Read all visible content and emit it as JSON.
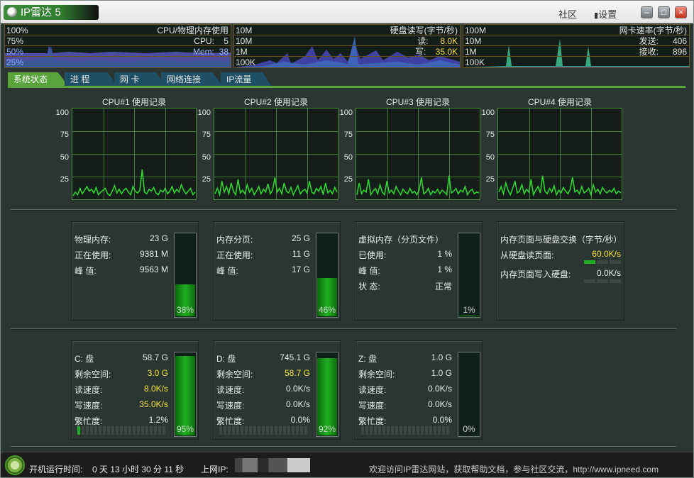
{
  "app": {
    "title": "IP雷达 5",
    "community": "社区",
    "settings": "设置",
    "settings_icon": "gear-icon"
  },
  "monitors": {
    "cpu": {
      "levels": [
        "100%",
        "75%",
        "50%",
        "25%"
      ],
      "title": "CPU/物理内存使用",
      "cpu_label": "CPU:",
      "cpu_value": "5",
      "mem_label": "Mem:",
      "mem_value": "38"
    },
    "disk": {
      "levels": [
        "10M",
        "10M",
        "1M",
        "100K"
      ],
      "title": "硬盘读写(字节/秒)",
      "read_label": "读:",
      "read_value": "8.0K",
      "write_label": "写:",
      "write_value": "35.0K"
    },
    "net": {
      "levels": [
        "100M",
        "10M",
        "1M",
        "100K"
      ],
      "title": "网卡速率(字节/秒)",
      "send_label": "发送:",
      "send_value": "406",
      "recv_label": "接收:",
      "recv_value": "896"
    }
  },
  "tabs": [
    "系统状态",
    "进  程",
    "网  卡",
    "网络连接",
    "IP流量"
  ],
  "active_tab": 0,
  "cpu_titles": [
    "CPU#1 使用记录",
    "CPU#2 使用记录",
    "CPU#3 使用记录",
    "CPU#4 使用记录"
  ],
  "y_ticks": [
    "100",
    "75",
    "50",
    "25"
  ],
  "chart_data": {
    "type": "line",
    "ylim": [
      0,
      100
    ],
    "series": [
      {
        "name": "CPU#1 使用记录",
        "values": [
          4,
          8,
          5,
          12,
          6,
          10,
          14,
          9,
          11,
          7,
          13,
          5,
          8,
          10,
          12,
          6,
          4,
          9,
          15,
          7,
          11,
          6,
          10,
          12,
          8,
          5,
          14,
          9,
          7,
          10,
          33,
          8,
          6,
          11,
          9,
          13,
          7,
          5,
          10,
          8,
          12,
          6,
          9,
          14,
          7,
          11,
          8,
          16,
          10,
          6,
          9,
          12,
          5,
          8
        ]
      },
      {
        "name": "CPU#2 使用记录",
        "values": [
          6,
          12,
          5,
          20,
          8,
          14,
          6,
          18,
          9,
          5,
          22,
          7,
          10,
          6,
          16,
          8,
          12,
          5,
          9,
          14,
          6,
          11,
          8,
          17,
          6,
          10,
          24,
          8,
          12,
          6,
          18,
          9,
          7,
          13,
          5,
          10,
          15,
          6,
          9,
          11,
          7,
          20,
          8,
          6,
          12,
          9,
          14,
          5,
          18,
          7,
          10,
          6,
          13,
          8
        ]
      },
      {
        "name": "CPU#3 使用记录",
        "values": [
          5,
          18,
          6,
          10,
          8,
          22,
          5,
          9,
          12,
          6,
          16,
          8,
          5,
          20,
          7,
          10,
          6,
          14,
          9,
          5,
          11,
          8,
          6,
          12,
          7,
          9,
          5,
          10,
          24,
          6,
          8,
          12,
          5,
          9,
          7,
          11,
          6,
          10,
          8,
          5,
          26,
          7,
          9,
          12,
          6,
          10,
          8,
          14,
          5,
          9,
          11,
          6,
          8,
          7
        ]
      },
      {
        "name": "CPU#4 使用记录",
        "values": [
          8,
          14,
          6,
          18,
          10,
          5,
          12,
          20,
          7,
          9,
          16,
          6,
          11,
          8,
          22,
          5,
          10,
          14,
          7,
          26,
          9,
          6,
          12,
          8,
          15,
          5,
          10,
          7,
          13,
          9,
          6,
          11,
          24,
          8,
          10,
          6,
          14,
          7,
          9,
          12,
          5,
          16,
          8,
          11,
          6,
          13,
          9,
          7,
          10,
          8,
          12,
          6,
          9,
          7
        ]
      }
    ]
  },
  "mem_panels": [
    {
      "rows": [
        [
          "物理内存:",
          "23 G"
        ],
        [
          "正在使用:",
          "9381 M"
        ],
        [
          "峰    值:",
          "9563 M"
        ]
      ],
      "pct": "38%",
      "level": 38
    },
    {
      "rows": [
        [
          "内存分页:",
          "25 G"
        ],
        [
          "正在使用:",
          "11 G"
        ],
        [
          "峰    值:",
          "17 G"
        ]
      ],
      "pct": "46%",
      "level": 46
    },
    {
      "rows": [
        [
          "虚拟内存（分页文件）",
          ""
        ],
        [
          "已使用:",
          "1 %"
        ],
        [
          "峰    值:",
          "1 %"
        ],
        [
          "状    态:",
          "正常"
        ]
      ],
      "pct": "1%",
      "level": 1
    }
  ],
  "swap_panel": {
    "title": "内存页面与硬盘交换（字节/秒）",
    "read_label": "从硬盘读页面:",
    "read_value": "60.0K/s",
    "write_label": "内存页面写入硬盘:",
    "write_value": "0.0K/s"
  },
  "disk_panels": [
    {
      "name": "C: 盘",
      "size": "58.7 G",
      "free_label": "剩余空间:",
      "free": "3.0 G",
      "free_warn": true,
      "rspeed_label": "读速度:",
      "rspeed": "8.0K/s",
      "rwarn": true,
      "wspeed_label": "写速度:",
      "wspeed": "35.0K/s",
      "wwarn": true,
      "busy_label": "繁忙度:",
      "busy": "1.2%",
      "busy_level": 1.2,
      "pct": "95%",
      "level": 95
    },
    {
      "name": "D: 盘",
      "size": "745.1 G",
      "free_label": "剩余空间:",
      "free": "58.7 G",
      "free_warn": true,
      "rspeed_label": "读速度:",
      "rspeed": "0.0K/s",
      "rwarn": false,
      "wspeed_label": "写速度:",
      "wspeed": "0.0K/s",
      "wwarn": false,
      "busy_label": "繁忙度:",
      "busy": "0.0%",
      "busy_level": 0,
      "pct": "92%",
      "level": 92
    },
    {
      "name": "Z: 盘",
      "size": "1.0 G",
      "free_label": "剩余空间:",
      "free": "1.0 G",
      "free_warn": false,
      "rspeed_label": "读速度:",
      "rspeed": "0.0K/s",
      "rwarn": false,
      "wspeed_label": "写速度:",
      "wspeed": "0.0K/s",
      "wwarn": false,
      "busy_label": "繁忙度:",
      "busy": "0.0%",
      "busy_level": 0,
      "pct": "0%",
      "level": 0
    }
  ],
  "status": {
    "uptime_label": "开机运行时间:",
    "uptime": "0 天 13 小时 30 分 11 秒",
    "ip_label": "上网IP:",
    "welcome": "欢迎访问IP雷达网站，获取帮助文档，参与社区交流，http://www.ipneed.com"
  },
  "colors": {
    "accent": "#58a43a",
    "tab": "#1f4f64",
    "bg": "#2b3532",
    "warn": "#f2e23a",
    "line": "#2fd22f"
  }
}
